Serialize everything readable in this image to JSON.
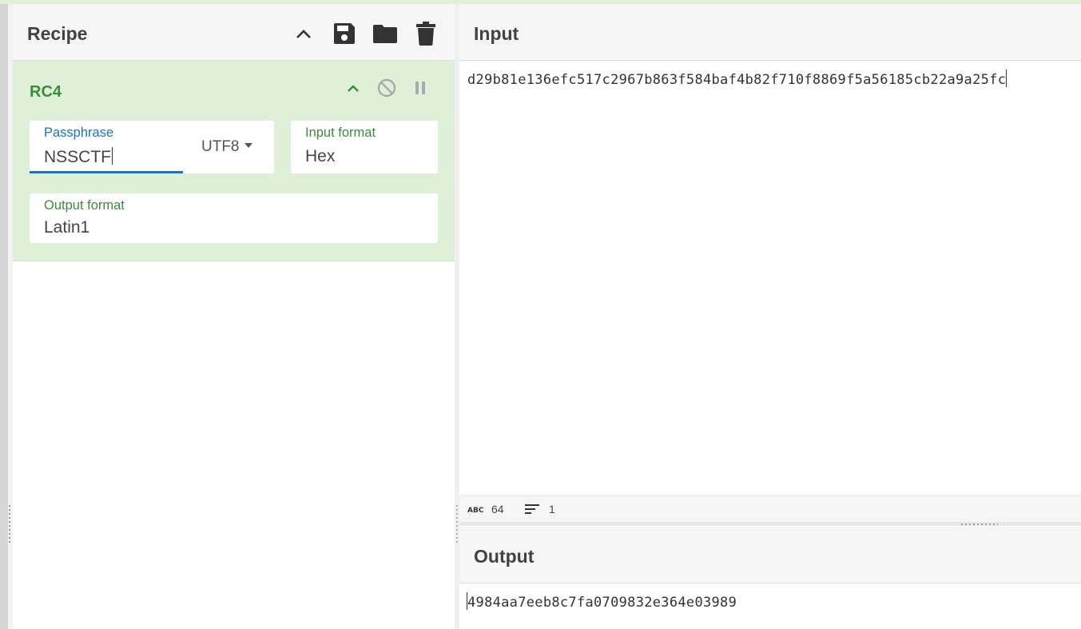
{
  "recipe": {
    "title": "Recipe"
  },
  "operation": {
    "name": "RC4",
    "passphrase": {
      "label": "Passphrase",
      "value": "NSSCTF",
      "encoding": "UTF8"
    },
    "input_format": {
      "label": "Input format",
      "value": "Hex"
    },
    "output_format": {
      "label": "Output format",
      "value": "Latin1"
    }
  },
  "input": {
    "title": "Input",
    "text": "d29b81e136efc517c2967b863f584baf4b82f710f8869f5a56185cb22a9a25fc",
    "status": {
      "char_count": "64",
      "line_count": "1"
    }
  },
  "output": {
    "title": "Output",
    "text": "4984aa7eeb8c7fa0709832e364e03989"
  },
  "colors": {
    "operation_bg": "#dff0d8",
    "accent_green": "#3c8b3c",
    "accent_blue": "#1a73c8"
  },
  "icons": [
    "chevron-up-icon",
    "save-icon",
    "folder-icon",
    "trash-icon",
    "disable-icon",
    "pause-icon",
    "abc-icon",
    "lines-icon"
  ]
}
